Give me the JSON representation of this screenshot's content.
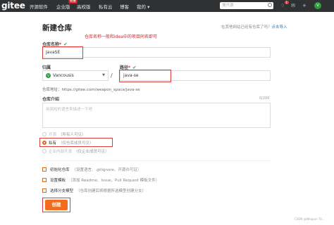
{
  "nav": {
    "logo": "gitee",
    "items": [
      "开源软件",
      "企业版",
      "高校版",
      "私有云",
      "博客",
      "我的 ▾"
    ],
    "enterprise_badge": "特惠",
    "search_placeholder": "搜开源",
    "notification_count": "1",
    "avatar_letter": "V"
  },
  "page": {
    "title": "新建仓库",
    "import_hint_prefix": "在其他网站已经有仓库了吗？",
    "import_link": "点击导入",
    "annotation": "仓库名称一般和idea中的项目同名即可"
  },
  "form": {
    "repo_name_label": "仓库名称",
    "repo_name_required": "*",
    "repo_name_value": "JavaSE",
    "owner_label": "归属",
    "owner_value": "Vancousis",
    "owner_avatar": "V",
    "path_label": "路径",
    "path_required": "*",
    "path_value": "java-se",
    "address_label": "仓库地址：",
    "address_value": "https://gitee.com/weapon_space/java-se",
    "intro_label": "仓库介绍",
    "intro_placeholder": "用简短的语言来描述一下吧",
    "intro_counter": "0/200",
    "visibility": [
      {
        "label": "开源",
        "sub": "（所有人可见）",
        "selected": false
      },
      {
        "label": "私有",
        "sub": "（仅仓库成员可见）",
        "selected": true
      },
      {
        "label": "企业内部开源",
        "sub": "（仅企业成员可见）",
        "selected": false
      }
    ],
    "options": [
      {
        "label": "初始化仓库",
        "sub": "（设置语言、.gitignore、开源许可证）"
      },
      {
        "label": "设置模板",
        "sub": "（添加 Readme、Issue、Pull Request 模板文件）"
      },
      {
        "label": "选择分支模型",
        "sub": "（仓库创建后将根据所选模型创建分支）"
      }
    ],
    "submit": "创建"
  },
  "watermark": "CSDN @Weapon Tsi..."
}
